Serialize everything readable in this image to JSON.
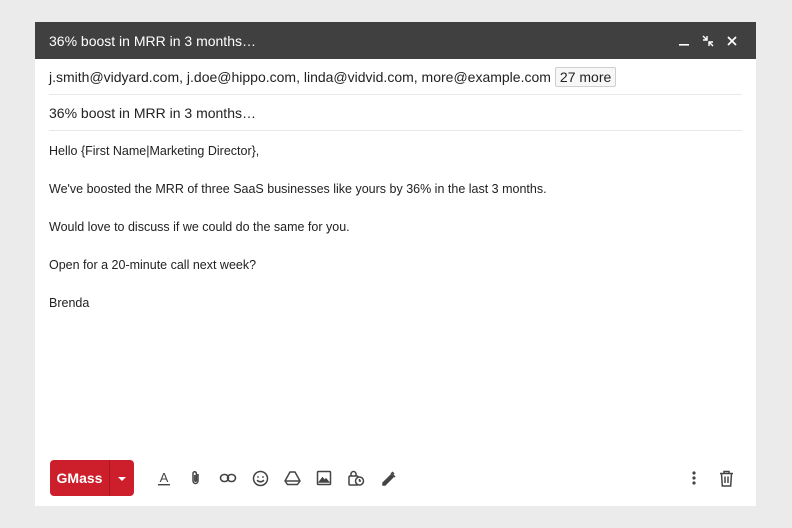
{
  "window": {
    "title": "36% boost in MRR in 3 months…",
    "minimize_icon": "minimize-icon",
    "exit_fullscreen_icon": "exit-fullscreen-icon",
    "close_icon": "close-icon"
  },
  "recipients": {
    "list": "j.smith@vidyard.com, j.doe@hippo.com, linda@vidvid.com, more@example.com",
    "more_chip": "27 more"
  },
  "subject": "36% boost in MRR in 3 months…",
  "body": {
    "lines": [
      "Hello {First Name|Marketing Director},",
      "We've boosted the MRR of three SaaS businesses like yours by 36% in the last 3 months.",
      "Would love to discuss if we could do the same for you.",
      "Open for a 20-minute call next week?",
      "Brenda"
    ]
  },
  "toolbar": {
    "send_label": "GMass",
    "icons": [
      "format-text-icon",
      "attach-icon",
      "link-icon",
      "emoji-icon",
      "drive-icon",
      "photo-icon",
      "confidential-icon",
      "signature-icon",
      "more-options-icon",
      "trash-icon"
    ]
  },
  "colors": {
    "titlebar": "#404040",
    "send_button": "#cc1f2b",
    "background": "#ebebeb"
  }
}
